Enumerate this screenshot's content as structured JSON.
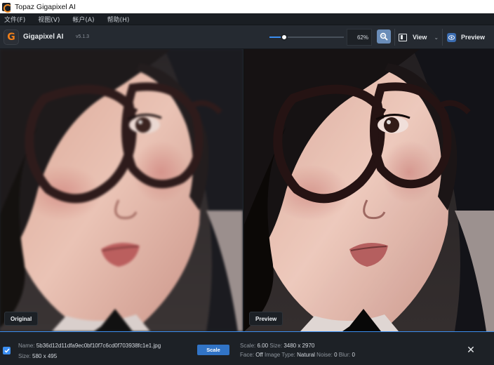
{
  "titlebar": {
    "title": "Topaz Gigapixel AI",
    "icon": "topaz-logo-icon"
  },
  "menu": [
    {
      "label": "文件(F)"
    },
    {
      "label": "视图(V)"
    },
    {
      "label": "帐户(A)"
    },
    {
      "label": "帮助(H)"
    }
  ],
  "toolbar": {
    "logo_letter": "G",
    "app_name": "Gigapixel AI",
    "version": "v5.1.3",
    "zoom_value": "62%",
    "zoom_level": 0.2,
    "view_label": "View",
    "preview_label": "Preview"
  },
  "panels": {
    "original_label": "Original",
    "preview_label": "Preview"
  },
  "file": {
    "name_label": "Name:",
    "name": "5b36d12d11dfa9ec0bf10f7c6cd0f703938fc1e1.jpg",
    "size_label": "Size:",
    "size": "580 x 495",
    "checked": true
  },
  "settings": {
    "scale_button": "Scale",
    "scale_label": "Scale:",
    "scale_value": "6.00",
    "out_size_label": "Size:",
    "out_size": "3480 x 2970",
    "face_label": "Face:",
    "face_value": "Off",
    "image_type_label": "Image Type:",
    "image_type_value": "Natural",
    "noise_label": "Noise:",
    "noise_value": "0",
    "blur_label": "Blur:",
    "blur_value": "0"
  },
  "colors": {
    "accent": "#3b8ef0",
    "logo": "#ef7f1a",
    "background": "#1f242b"
  }
}
